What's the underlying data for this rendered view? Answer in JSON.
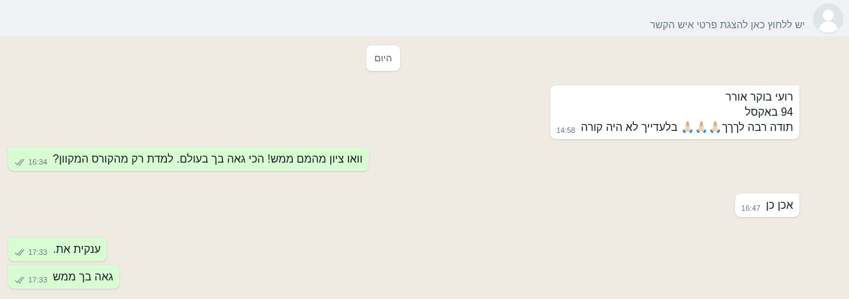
{
  "header": {
    "subtitle": "יש ללחוץ כאן להצגת פרטי איש הקשר"
  },
  "date_separator": "היום",
  "messages": [
    {
      "kind": "incoming",
      "lines": [
        "רועי בוקר אורר",
        "94 באקסל",
        "תודה רבה לךךך🙏🏻🙏🏻🙏🏻 בלעדייך לא היה קורה"
      ],
      "time": "14:58"
    },
    {
      "kind": "outgoing",
      "lines": [
        "וואו ציון מהמם ממש! הכי גאה בך בעולם. למדת רק מהקורס המקוון?"
      ],
      "time": "16:34",
      "read": false
    },
    {
      "kind": "incoming",
      "lines": [
        "אכן כן"
      ],
      "time": "16:47"
    },
    {
      "kind": "outgoing",
      "lines": [
        "ענקית את."
      ],
      "time": "17:33",
      "read": false
    },
    {
      "kind": "outgoing",
      "lines": [
        "גאה בך ממש"
      ],
      "time": "17:33",
      "read": false
    }
  ]
}
